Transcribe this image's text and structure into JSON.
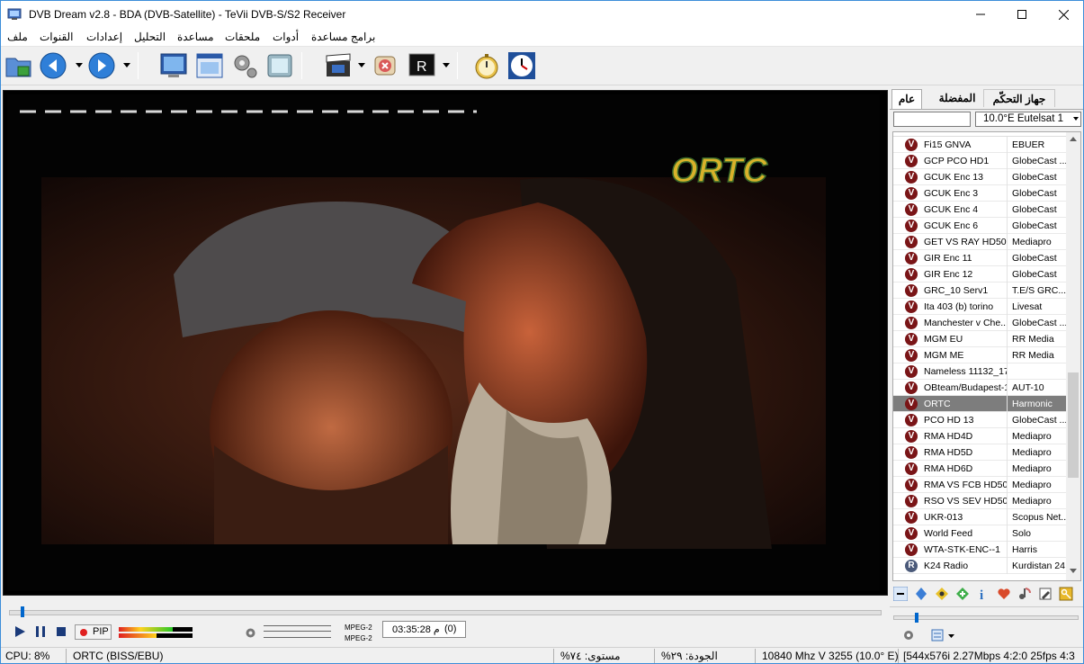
{
  "window": {
    "title": "DVB Dream v2.8 - BDA (DVB-Satellite)  -  TeVii DVB-S/S2 Receiver"
  },
  "menu": [
    "ملف",
    "القنوات",
    "إعدادات",
    "التحليل",
    "مساعدة",
    "ملحقات",
    "أدوات",
    "برامج مساعدة"
  ],
  "toolbar": {
    "icons": [
      "open-folder-icon",
      "back-icon",
      "forward-icon",
      "screen-icon",
      "window-icon",
      "settings-gears-icon",
      "snapshot-icon",
      "clapboard-icon",
      "stop-record-icon",
      "record-icon",
      "timer-icon",
      "epg-clock-icon"
    ]
  },
  "video": {
    "channel_logo": "ORTC"
  },
  "panel": {
    "tabs": [
      "عام",
      "المفضلة",
      "جهاز التحكّم"
    ],
    "filter_value": "",
    "satellite": "10.0°E Eutelsat 1",
    "channels": [
      {
        "name": "Fi15 GNVA",
        "provider": "EBUER",
        "type": "V"
      },
      {
        "name": "GCP PCO HD1",
        "provider": "GlobeCast ...",
        "type": "V"
      },
      {
        "name": "GCUK Enc 13",
        "provider": "GlobeCast",
        "type": "V"
      },
      {
        "name": "GCUK Enc 3",
        "provider": "GlobeCast",
        "type": "V"
      },
      {
        "name": "GCUK Enc 4",
        "provider": "GlobeCast",
        "type": "V"
      },
      {
        "name": "GCUK Enc 6",
        "provider": "GlobeCast",
        "type": "V"
      },
      {
        "name": "GET VS RAY HD50",
        "provider": "Mediapro",
        "type": "V"
      },
      {
        "name": "GIR Enc 11",
        "provider": "GlobeCast",
        "type": "V"
      },
      {
        "name": "GIR Enc 12",
        "provider": "GlobeCast",
        "type": "V"
      },
      {
        "name": "GRC_10 Serv1",
        "provider": "T.E/S GRC...",
        "type": "V"
      },
      {
        "name": "Ita 403 (b) torino",
        "provider": "Livesat",
        "type": "V"
      },
      {
        "name": "Manchester v Che...",
        "provider": "GlobeCast ...",
        "type": "V"
      },
      {
        "name": "MGM EU",
        "provider": "RR Media",
        "type": "V"
      },
      {
        "name": "MGM ME",
        "provider": "RR Media",
        "type": "V"
      },
      {
        "name": "Nameless 11132_17",
        "provider": "",
        "type": "V"
      },
      {
        "name": "OBteam/Budapest-1",
        "provider": "AUT-10",
        "type": "V"
      },
      {
        "name": "ORTC",
        "provider": "Harmonic",
        "type": "V",
        "selected": true
      },
      {
        "name": "PCO HD 13",
        "provider": "GlobeCast ...",
        "type": "V"
      },
      {
        "name": "RMA HD4D",
        "provider": "Mediapro",
        "type": "V"
      },
      {
        "name": "RMA HD5D",
        "provider": "Mediapro",
        "type": "V"
      },
      {
        "name": "RMA HD6D",
        "provider": "Mediapro",
        "type": "V"
      },
      {
        "name": "RMA VS FCB HD50",
        "provider": "Mediapro",
        "type": "V"
      },
      {
        "name": "RSO VS SEV HD50",
        "provider": "Mediapro",
        "type": "V"
      },
      {
        "name": "UKR-013",
        "provider": "Scopus Net...",
        "type": "V"
      },
      {
        "name": "World Feed",
        "provider": "Solo",
        "type": "V"
      },
      {
        "name": "WTA-STK-ENC--1",
        "provider": "Harris",
        "type": "V"
      },
      {
        "name": "K24 Radio",
        "provider": "Kurdistan 24",
        "type": "R"
      }
    ]
  },
  "controls": {
    "pip_label": "PIP",
    "codec_video": "MPEG-2",
    "codec_audio": "MPEG-2",
    "time": "03:35:28 م",
    "counter": "(0)"
  },
  "status": {
    "cpu": "CPU: 8%",
    "channel": "ORTC (BISS/EBU)",
    "level": "%مستوى: ٧٤",
    "quality": "%الجودة: ٢٩",
    "tuning": "10840 Mhz  V  3255  (10.0° E)",
    "stream": "[544x576i  2.27Mbps 4:2:0 25fps 4:3"
  },
  "colors": {
    "selected_row": "#7d7d7d",
    "channel_icon": "#7a1517",
    "seek_thumb": "#0066cc"
  }
}
